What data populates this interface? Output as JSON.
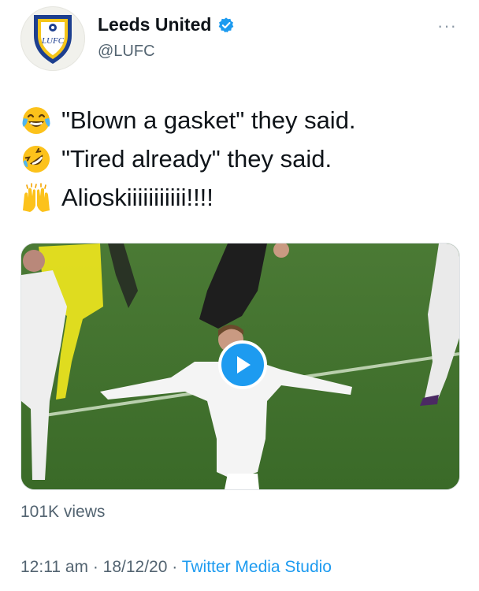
{
  "author": {
    "display_name": "Leeds United",
    "handle": "@LUFC",
    "verified": true,
    "crest_text": "LUFC"
  },
  "more_label": "···",
  "tweet": {
    "lines": [
      {
        "emoji": "face-with-tears-of-joy",
        "text": "\"Blown a gasket\" they said."
      },
      {
        "emoji": "rolling-on-the-floor-laughing",
        "text": "\"Tired already\" they said."
      },
      {
        "emoji": "raising-hands",
        "text": "Alioskiiiiiiiiiii!!!!"
      }
    ]
  },
  "media": {
    "type": "video",
    "play_icon": "play-icon"
  },
  "stats": {
    "views": "101K views"
  },
  "meta": {
    "time": "12:11 am",
    "separator1": " · ",
    "date": "18/12/20",
    "separator2": " · ",
    "source": "Twitter Media Studio"
  },
  "colors": {
    "link_blue": "#1d9bf0",
    "secondary_text": "#536471",
    "pitch_green": "#3b6127"
  }
}
